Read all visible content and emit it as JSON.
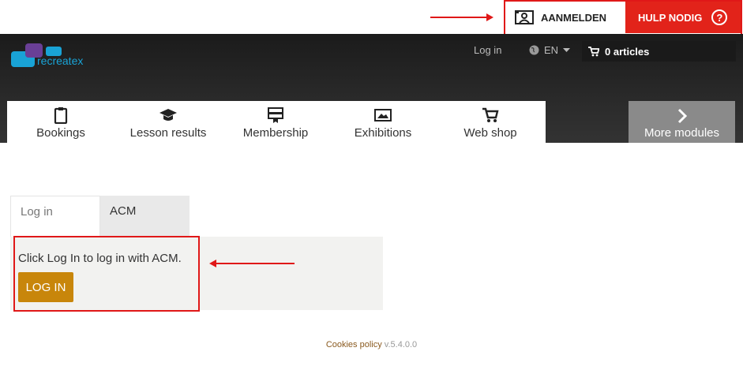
{
  "acm": {
    "signin_label": "AANMELDEN",
    "help_label": "HULP NODIG",
    "help_icon": "question-circle-icon"
  },
  "header": {
    "logo_text": "recreatex",
    "login_label": "Log in",
    "language": "EN",
    "cart_label": "0 articles"
  },
  "modules": [
    {
      "label": "Bookings",
      "icon": "clipboard-icon"
    },
    {
      "label": "Lesson results",
      "icon": "graduation-cap-icon"
    },
    {
      "label": "Membership",
      "icon": "membership-card-icon"
    },
    {
      "label": "Exhibitions",
      "icon": "picture-icon"
    },
    {
      "label": "Web shop",
      "icon": "cart-icon"
    }
  ],
  "more_modules": {
    "label": "More modules"
  },
  "login_tabs": [
    {
      "label": "Log in"
    },
    {
      "label": "ACM"
    }
  ],
  "panel": {
    "message": "Click Log In to log in with ACM.",
    "button_label": "LOG IN"
  },
  "footer": {
    "cookies_label": "Cookies policy",
    "version": "v.5.4.0.0"
  },
  "colors": {
    "accent_red": "#e2231a",
    "login_button": "#c8860b",
    "logo_blue": "#19a3d6",
    "logo_purple": "#6a3f96"
  }
}
